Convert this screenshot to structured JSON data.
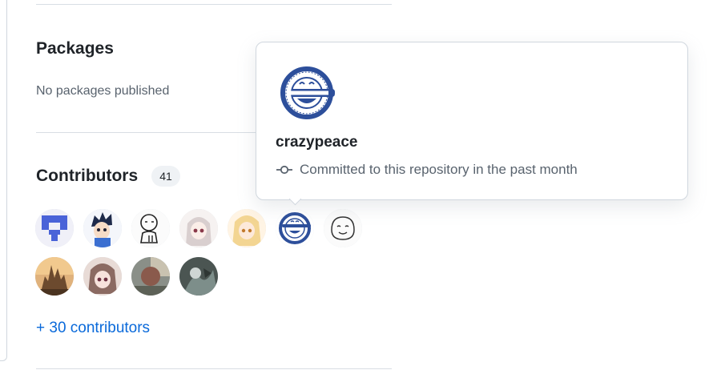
{
  "packages": {
    "title": "Packages",
    "empty_text": "No packages published"
  },
  "contributors": {
    "title": "Contributors",
    "count": "41",
    "more_link": "+ 30 contributors",
    "avatars": [
      {
        "icon": "identicon-avatar"
      },
      {
        "icon": "anime-boy-avatar"
      },
      {
        "icon": "sketch-character-avatar"
      },
      {
        "icon": "anime-girl-avatar"
      },
      {
        "icon": "blonde-anime-avatar"
      },
      {
        "icon": "laughing-man-avatar"
      },
      {
        "icon": "doodle-face-avatar"
      },
      {
        "icon": "castle-landscape-avatar"
      },
      {
        "icon": "brown-hair-anime-avatar"
      },
      {
        "icon": "silhouette-avatar"
      },
      {
        "icon": "dark-artwork-avatar"
      }
    ]
  },
  "hovercard": {
    "username": "crazypeace",
    "status": "Committed to this repository in the past month",
    "status_icon": "git-commit-icon"
  },
  "colors": {
    "link": "#0969da",
    "muted": "#59636e",
    "text": "#1f2328",
    "laughing_man_blue": "#2d4f9b"
  }
}
